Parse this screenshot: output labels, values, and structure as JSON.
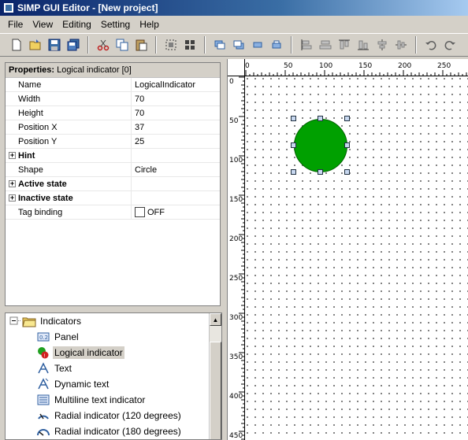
{
  "window": {
    "title": "SIMP GUI Editor - [New project]"
  },
  "menu": [
    "File",
    "View",
    "Editing",
    "Setting",
    "Help"
  ],
  "toolbar": {
    "icons": [
      "new-file-icon",
      "open-folder-icon",
      "save-icon",
      "save-all-icon",
      "cut-icon",
      "copy-icon",
      "paste-icon",
      "select-all-icon",
      "select-grid-icon",
      "bring-front-icon",
      "send-back-icon",
      "align-group1-icon",
      "align-group2-icon",
      "align-left-icon",
      "align-center-icon",
      "align-top-icon",
      "align-bottom-icon",
      "distribute-h-icon",
      "distribute-v-icon",
      "undo-icon",
      "redo-icon"
    ]
  },
  "properties": {
    "header_label": "Properties:",
    "header_value": "Logical indicator [0]",
    "rows": [
      {
        "name": "Name",
        "value": "LogicalIndicator"
      },
      {
        "name": "Width",
        "value": "70"
      },
      {
        "name": "Height",
        "value": "70"
      },
      {
        "name": "Position X",
        "value": "37"
      },
      {
        "name": "Position Y",
        "value": "25"
      },
      {
        "name": "Hint",
        "value": "",
        "group": true
      },
      {
        "name": "Shape",
        "value": "Circle"
      },
      {
        "name": "Active state",
        "value": "",
        "group": true
      },
      {
        "name": "Inactive state",
        "value": "",
        "group": true
      },
      {
        "name": "Tag binding",
        "value": "OFF",
        "checkbox": true
      }
    ]
  },
  "tree": {
    "root": "Indicators",
    "items": [
      {
        "label": "Panel",
        "icon": "panel-icon"
      },
      {
        "label": "Logical indicator",
        "icon": "logical-indicator-icon",
        "selected": true
      },
      {
        "label": "Text",
        "icon": "text-icon"
      },
      {
        "label": "Dynamic text",
        "icon": "dynamic-text-icon"
      },
      {
        "label": "Multiline text indicator",
        "icon": "multiline-text-icon"
      },
      {
        "label": "Radial indicator (120 degrees)",
        "icon": "radial-120-icon"
      },
      {
        "label": "Radial indicator (180 degrees)",
        "icon": "radial-180-icon"
      }
    ]
  },
  "ruler": {
    "top": [
      "0",
      "50",
      "100",
      "150",
      "200",
      "250"
    ],
    "left": [
      "0",
      "50",
      "100",
      "150",
      "200",
      "250",
      "300",
      "350",
      "400",
      "450"
    ]
  },
  "canvas": {
    "indicator_color": "#00a000",
    "grid_color": "#606060"
  }
}
